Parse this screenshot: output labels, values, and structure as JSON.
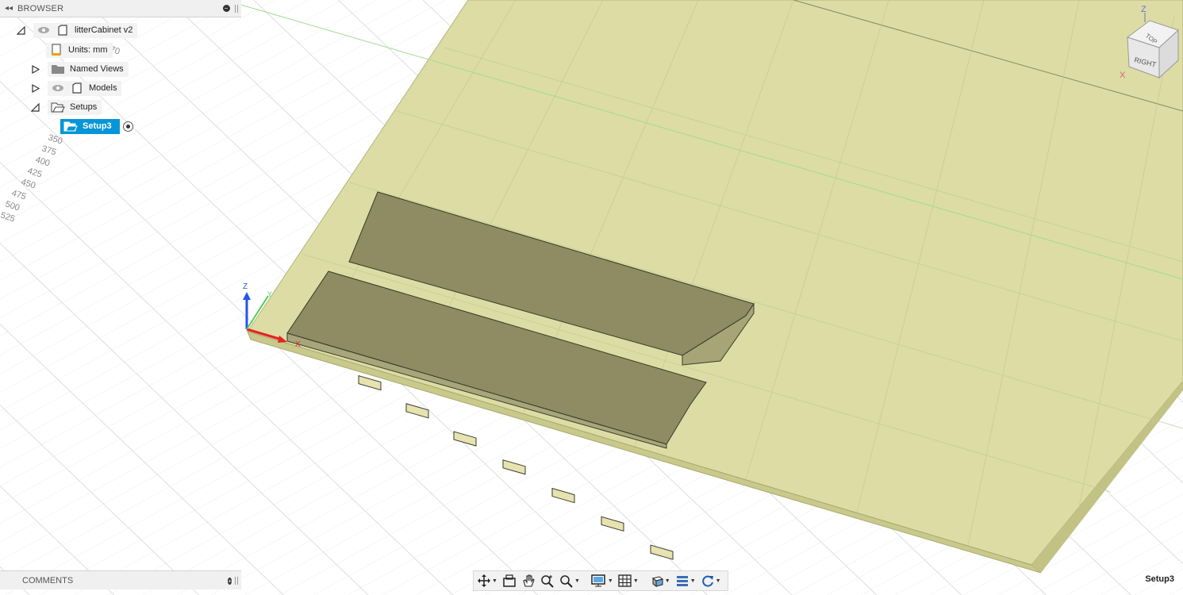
{
  "browser": {
    "title": "BROWSER",
    "items": [
      {
        "label": "litterCabinet v2"
      },
      {
        "label": "Units: mm"
      },
      {
        "label": "Named Views"
      },
      {
        "label": "Models"
      },
      {
        "label": "Setups"
      },
      {
        "label": "Setup3"
      }
    ]
  },
  "comments": {
    "title": "COMMENTS"
  },
  "status": {
    "active_setup": "Setup3"
  },
  "viewcube": {
    "top": "TOP",
    "right": "RIGHT",
    "z": "Z",
    "x": "X"
  },
  "triad": {
    "x": "X",
    "y": "Y",
    "z": "Z"
  },
  "ruler": {
    "labels": [
      "70",
      "350",
      "375",
      "400",
      "425",
      "450",
      "475",
      "500",
      "525"
    ]
  },
  "icons": {
    "collapse": "double-left-arrow-icon",
    "visibility": "eye-icon",
    "component": "component-icon",
    "units": "document-icon",
    "folder": "folder-icon",
    "setup": "setup-folder-icon"
  },
  "toolbar": {
    "tools": [
      "orbit",
      "look-at",
      "pan",
      "zoom",
      "zoom-window",
      "display-settings",
      "grid",
      "visual-style",
      "layout",
      "refresh"
    ]
  },
  "colors": {
    "accent": "#0696d7",
    "stock": "#d9d9a0",
    "part": "#8f8b62",
    "grid": "#dcdcdc"
  }
}
